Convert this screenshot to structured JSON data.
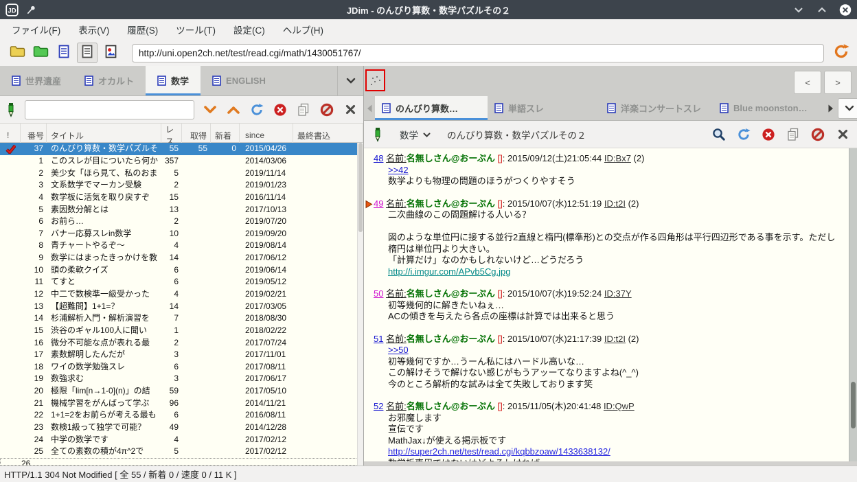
{
  "titlebar": {
    "title": "JDim - のんびり算数・数学パズルその２"
  },
  "menubar": {
    "items": [
      "ファイル(F)",
      "表示(V)",
      "履歴(S)",
      "ツール(T)",
      "設定(C)",
      "ヘルプ(H)"
    ]
  },
  "toolbar": {
    "url": "http://uni.open2ch.net/test/read.cgi/math/1430051767/"
  },
  "left_pane": {
    "tabs": [
      {
        "label": "世界遺産",
        "active": false
      },
      {
        "label": "オカルト",
        "active": false
      },
      {
        "label": "数学",
        "active": true
      },
      {
        "label": "ENGLISH",
        "active": false
      }
    ],
    "columns": [
      "!",
      "番号",
      "タイトル",
      "レス",
      "取得",
      "新着",
      "since",
      "最終書込"
    ],
    "rows": [
      {
        "num": "37",
        "title": "のんびり算数・数学パズルそ",
        "res": "55",
        "got": "55",
        "new": "0",
        "since": "2015/04/26",
        "selected": true,
        "check": true
      },
      {
        "num": "1",
        "title": "このスレが目についたら何か",
        "res": "357",
        "since": "2014/03/06"
      },
      {
        "num": "2",
        "title": "美少女「ほら見て、私のおま",
        "res": "5",
        "since": "2019/11/14"
      },
      {
        "num": "3",
        "title": "文系数学でマーカン受験",
        "res": "2",
        "since": "2019/01/23"
      },
      {
        "num": "4",
        "title": "数学板に活気を取り戻すぞ",
        "res": "15",
        "since": "2016/11/14"
      },
      {
        "num": "5",
        "title": "素因数分解とは",
        "res": "13",
        "since": "2017/10/13"
      },
      {
        "num": "6",
        "title": "お前ら…",
        "res": "2",
        "since": "2019/07/20"
      },
      {
        "num": "7",
        "title": "バナー応募スレin数学",
        "res": "10",
        "since": "2019/09/20"
      },
      {
        "num": "8",
        "title": "青チャートやるぞ～",
        "res": "4",
        "since": "2019/08/14"
      },
      {
        "num": "9",
        "title": "数学にはまったきっかけを教",
        "res": "14",
        "since": "2017/06/12"
      },
      {
        "num": "10",
        "title": "頭の柔軟クイズ",
        "res": "6",
        "since": "2019/06/14"
      },
      {
        "num": "11",
        "title": "てすと",
        "res": "6",
        "since": "2019/05/12"
      },
      {
        "num": "12",
        "title": "中二で数検準一級受かった",
        "res": "4",
        "since": "2019/02/21"
      },
      {
        "num": "13",
        "title": "【超難問】1+1=？",
        "res": "14",
        "since": "2017/03/05"
      },
      {
        "num": "14",
        "title": "杉浦解析入門・解析演習を",
        "res": "7",
        "since": "2018/08/30"
      },
      {
        "num": "15",
        "title": "渋谷のギャル100人に聞い",
        "res": "1",
        "since": "2018/02/22"
      },
      {
        "num": "16",
        "title": "微分不可能な点が表れる最",
        "res": "2",
        "since": "2017/07/24"
      },
      {
        "num": "17",
        "title": "素数解明したんだが",
        "res": "3",
        "since": "2017/11/01"
      },
      {
        "num": "18",
        "title": "ワイの数学勉強スレ",
        "res": "6",
        "since": "2017/08/11"
      },
      {
        "num": "19",
        "title": "数強求む",
        "res": "3",
        "since": "2017/06/17"
      },
      {
        "num": "20",
        "title": "極限「lim[n→1-0](n)」の結",
        "res": "59",
        "since": "2017/05/10"
      },
      {
        "num": "21",
        "title": "機械学習をがんばって学ぶ",
        "res": "96",
        "since": "2014/11/21"
      },
      {
        "num": "22",
        "title": "1+1=2をお前らが考える最も",
        "res": "6",
        "since": "2016/08/11"
      },
      {
        "num": "23",
        "title": "数検1級って独学で可能？",
        "res": "49",
        "since": "2014/12/28"
      },
      {
        "num": "24",
        "title": "中学の数学です",
        "res": "4",
        "since": "2017/02/12"
      },
      {
        "num": "25",
        "title": "全ての素数の積が4π^2で",
        "res": "5",
        "since": "2017/02/12"
      }
    ],
    "clipped_row": {
      "num": "26"
    }
  },
  "right_pane": {
    "nav": {
      "back": "<",
      "forward": ">"
    },
    "tabs": [
      {
        "label": "のんびり算数…",
        "active": true
      },
      {
        "label": "単語スレ",
        "active": false
      },
      {
        "label": "洋楽コンサートスレ",
        "active": false
      },
      {
        "label": "Blue moonston…",
        "active": false
      }
    ],
    "toolbar": {
      "board": "数学",
      "title": "のんびり算数・数学パズルその２"
    },
    "posts": [
      {
        "num": "48",
        "visited": false,
        "marker": false,
        "name_label": "名前:",
        "name": "名無しさん@おーぷん",
        "mail": "[]",
        "date": "2015/09/12(土)21:05:44",
        "id": "ID:Bx7",
        "count": "(2)",
        "lines": [
          {
            "type": "anchor",
            "text": ">>42"
          },
          {
            "type": "text",
            "text": "数学よりも物理の問題のほうがつくりやすそう"
          }
        ]
      },
      {
        "num": "49",
        "visited": true,
        "marker": true,
        "name_label": "名前:",
        "name": "名無しさん@おーぷん",
        "mail": "[]",
        "date": "2015/10/07(水)12:51:19",
        "id": "ID:t2I",
        "count": "(2)",
        "lines": [
          {
            "type": "text",
            "text": "二次曲線のこの問題解ける人いる？"
          },
          {
            "type": "blank"
          },
          {
            "type": "text",
            "text": "図のような単位円に接する並行2直線と楕円(標準形)との交点が作る四角形は平行四辺形である事を示す。ただし楕円は単位円より大きい。"
          },
          {
            "type": "text",
            "text": "「計算だけ」なのかもしれないけど…どうだろう"
          },
          {
            "type": "link_visited",
            "text": "http://i.imgur.com/APvb5Cg.jpg"
          }
        ]
      },
      {
        "num": "50",
        "visited": true,
        "marker": false,
        "name_label": "名前:",
        "name": "名無しさん@おーぷん",
        "mail": "[]",
        "date": "2015/10/07(水)19:52:24",
        "id": "ID:37Y",
        "count": "",
        "lines": [
          {
            "type": "text",
            "text": "初等幾何的に解きたいねぇ…"
          },
          {
            "type": "text",
            "text": "ACの傾きを与えたら各点の座標は計算では出来ると思う"
          }
        ]
      },
      {
        "num": "51",
        "visited": false,
        "marker": false,
        "name_label": "名前:",
        "name": "名無しさん@おーぷん",
        "mail": "[]",
        "date": "2015/10/07(水)21:17:39",
        "id": "ID:t2I",
        "count": "(2)",
        "lines": [
          {
            "type": "anchor",
            "text": ">>50"
          },
          {
            "type": "text",
            "text": "初等幾何ですか…うーん私にはハードル高いな…"
          },
          {
            "type": "text",
            "text": "この解けそうで解けない感じがもうアッーてなりますよね(^_^)"
          },
          {
            "type": "text",
            "text": "今のところ解析的な試みは全て失敗しております笑"
          }
        ]
      },
      {
        "num": "52",
        "visited": false,
        "marker": false,
        "name_label": "名前:",
        "name": "名無しさん@おーぷん",
        "mail": "[]",
        "date": "2015/11/05(木)20:41:48",
        "id": "ID:QwP",
        "count": "",
        "lines": [
          {
            "type": "text",
            "text": "お邪魔します"
          },
          {
            "type": "text",
            "text": "宣伝です"
          },
          {
            "type": "text",
            "text": "MathJax↓が使える掲示板です"
          },
          {
            "type": "link",
            "text": "http://super2ch.net/test/read.cgi/kqbbzoaw/1433638132/"
          },
          {
            "type": "text",
            "text": "数学板専用ではないけどよろしければ"
          }
        ]
      }
    ]
  },
  "statusbar": {
    "text": "HTTP/1.1 304 Not Modified [ 全 55 / 新着 0 / 速度 0 / 11 K ]"
  }
}
